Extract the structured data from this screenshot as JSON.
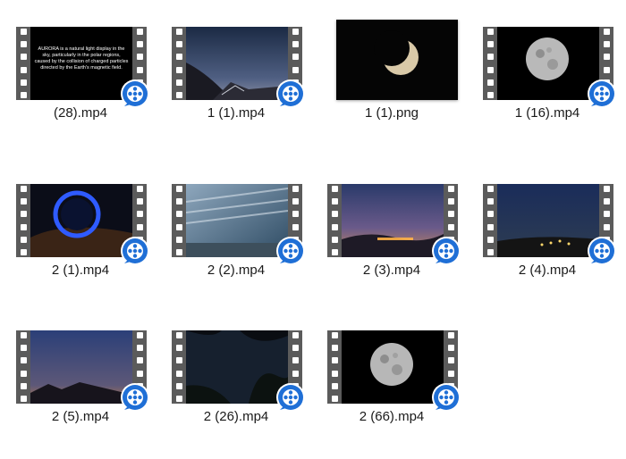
{
  "files": [
    {
      "name": "(28).mp4",
      "type": "video",
      "thumb": "aurora-text",
      "caption": "AURORA is a natural light display in the sky, particularly in the polar regions, caused by the collision of charged particles directed by the Earth's magnetic field."
    },
    {
      "name": "1 (1).mp4",
      "type": "video",
      "thumb": "mountain-dusk"
    },
    {
      "name": "1 (1).png",
      "type": "image",
      "thumb": "crescent-moon"
    },
    {
      "name": "1 (16).mp4",
      "type": "video",
      "thumb": "full-moon"
    },
    {
      "name": "2 (1).mp4",
      "type": "video",
      "thumb": "blue-ring"
    },
    {
      "name": "2 (2).mp4",
      "type": "video",
      "thumb": "cloud-streaks"
    },
    {
      "name": "2 (3).mp4",
      "type": "video",
      "thumb": "star-trails-town"
    },
    {
      "name": "2 (4).mp4",
      "type": "video",
      "thumb": "night-town"
    },
    {
      "name": "2 (5).mp4",
      "type": "video",
      "thumb": "twilight-hills"
    },
    {
      "name": "2 (26).mp4",
      "type": "video",
      "thumb": "tree-silhouette"
    },
    {
      "name": "2 (66).mp4",
      "type": "video",
      "thumb": "full-moon"
    }
  ],
  "colors": {
    "film": "#5b5b5b",
    "badge": "#1f6fd6",
    "label": "#1a1a1a"
  },
  "icons": {
    "badge": "video-player-icon"
  }
}
